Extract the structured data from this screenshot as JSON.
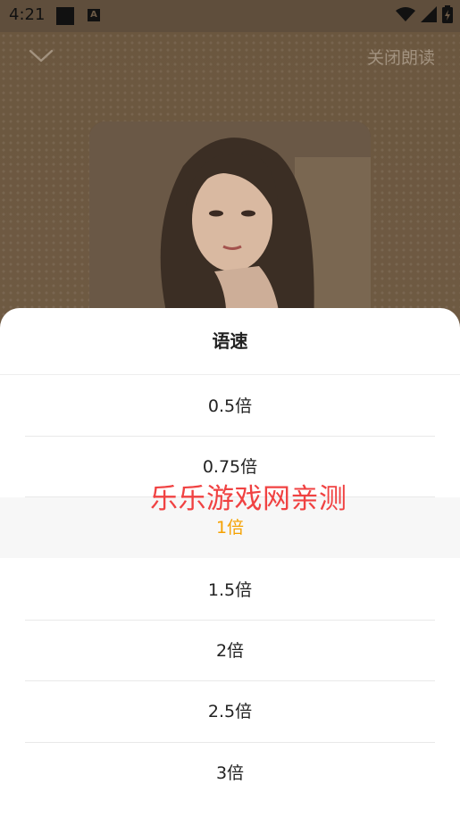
{
  "status_bar": {
    "time": "4:21",
    "icons": [
      "notification-square-icon",
      "a-icon",
      "wifi-icon",
      "signal-icon",
      "battery-icon"
    ]
  },
  "header": {
    "collapse_icon": "chevron-down-icon",
    "close_label": "关闭朗读"
  },
  "sheet": {
    "title": "语速",
    "options": [
      {
        "label": "0.5倍",
        "selected": false
      },
      {
        "label": "0.75倍",
        "selected": false
      },
      {
        "label": "1倍",
        "selected": true
      },
      {
        "label": "1.5倍",
        "selected": false
      },
      {
        "label": "2倍",
        "selected": false
      },
      {
        "label": "2.5倍",
        "selected": false
      },
      {
        "label": "3倍",
        "selected": false
      }
    ]
  },
  "watermark": "乐乐游戏网亲测",
  "colors": {
    "accent": "#f5a100",
    "watermark": "#f04242",
    "background": "#6f5a44"
  }
}
